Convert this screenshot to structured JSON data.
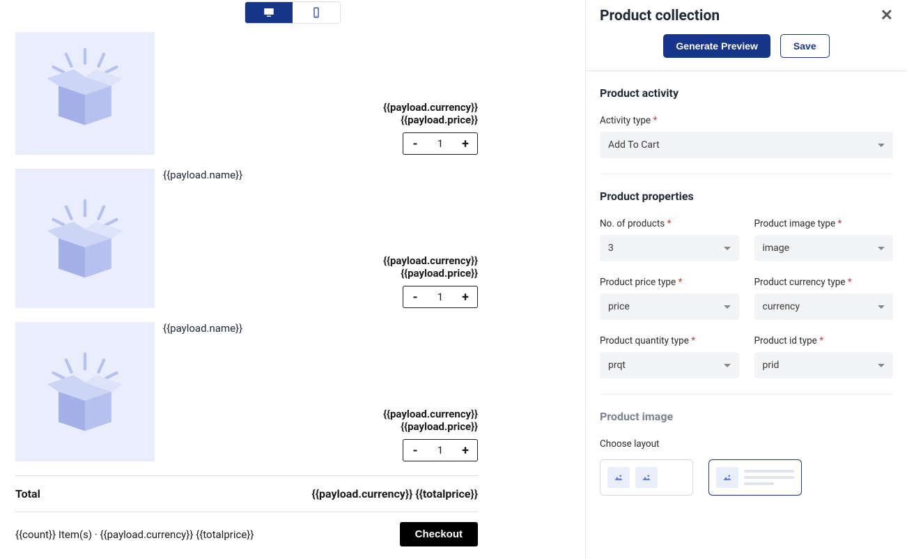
{
  "panel": {
    "title": "Product collection",
    "generate_preview": "Generate Preview",
    "save": "Save"
  },
  "sections": {
    "activity": {
      "title": "Product activity",
      "activity_type_label": "Activity type",
      "activity_type_value": "Add To Cart"
    },
    "properties": {
      "title": "Product properties",
      "num_products_label": "No. of products",
      "num_products_value": "3",
      "image_type_label": "Product image type",
      "image_type_value": "image",
      "price_type_label": "Product price type",
      "price_type_value": "price",
      "currency_type_label": "Product currency type",
      "currency_type_value": "currency",
      "quantity_type_label": "Product quantity type",
      "quantity_type_value": "prqt",
      "id_type_label": "Product id type",
      "id_type_value": "prid"
    },
    "image": {
      "title": "Product image",
      "choose_layout_label": "Choose layout"
    }
  },
  "preview": {
    "product_name": "{{payload.name}}",
    "currency": "{{payload.currency}}",
    "price": "{{payload.price}}",
    "qty": "1",
    "total_label": "Total",
    "total_value": "{{payload.currency}} {{totalprice}}",
    "footer_items": "{{count}} Item(s) · {{payload.currency}} {{totalprice}}",
    "checkout": "Checkout"
  }
}
